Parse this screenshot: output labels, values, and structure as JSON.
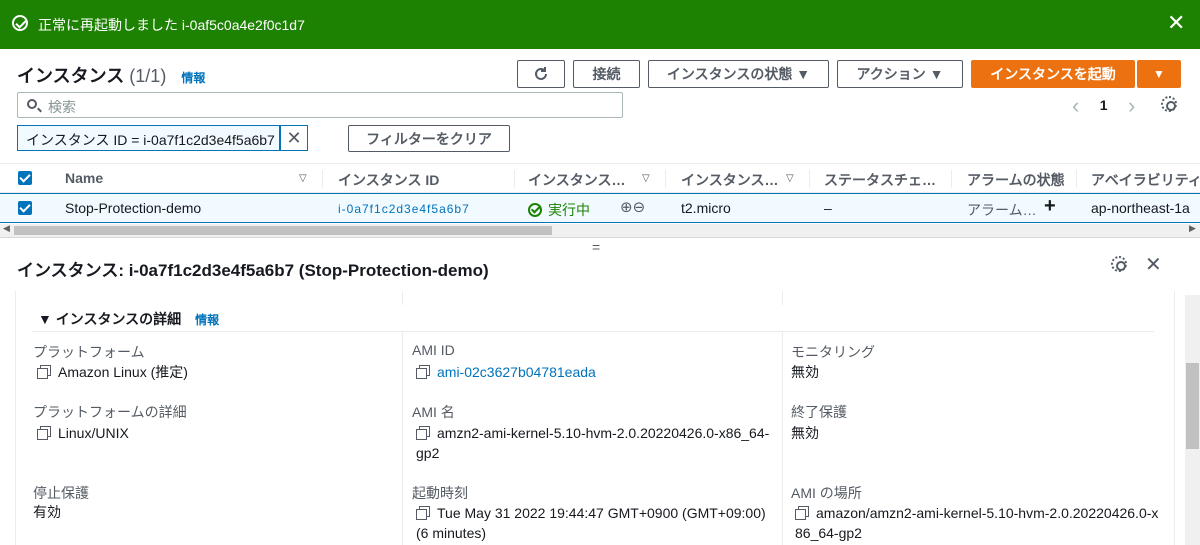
{
  "banner": {
    "message": "正常に再起動しました i-0af5c0a4e2f0c1d7",
    "close_icon": "✕"
  },
  "header": {
    "title": "インスタンス",
    "count": "(1/1)",
    "info": "情報",
    "connect_label": "接続",
    "state_label": "インスタンスの状態 ▼",
    "actions_label": "アクション ▼",
    "launch_label": "インスタンスを起動",
    "launch_dropdown": "▼"
  },
  "search": {
    "placeholder": "検索"
  },
  "filter": {
    "token": "インスタンス ID = i-0a7f1c2d3e4f5a6b7",
    "clear_label": "フィルターをクリア"
  },
  "pager": {
    "prev": "‹",
    "page": "1",
    "next": "›"
  },
  "table": {
    "headers": [
      "Name",
      "インスタンス ID",
      "インスタンス…",
      "インスタンス…",
      "ステータスチェ…",
      "アラームの状態",
      "アベイラビリティ…"
    ],
    "row": {
      "name": "Stop-Protection-demo",
      "instance_id": "i-0a7f1c2d3e4f5a6b7",
      "state": "実行中",
      "type": "t2.micro",
      "status_check": "–",
      "alarm": "アラーム…",
      "alarm_add": "+",
      "az": "ap-northeast-1a"
    }
  },
  "detail": {
    "grip": "=",
    "title": "インスタンス: i-0a7f1c2d3e4f5a6b7 (Stop-Protection-demo)",
    "section_title": "▼ インスタンスの詳細",
    "section_info": "情報",
    "fields": {
      "platform_label": "プラットフォーム",
      "platform_value": "Amazon Linux (推定)",
      "ami_id_label": "AMI ID",
      "ami_id_value": "ami-02c3627b04781eada",
      "monitoring_label": "モニタリング",
      "monitoring_value": "無効",
      "platform_details_label": "プラットフォームの詳細",
      "platform_details_value": "Linux/UNIX",
      "ami_name_label": "AMI 名",
      "ami_name_value": "amzn2-ami-kernel-5.10-hvm-2.0.20220426.0-x86_64-gp2",
      "term_protect_label": "終了保護",
      "term_protect_value": "無効",
      "stop_protect_label": "停止保護",
      "stop_protect_value": "有効",
      "launch_time_label": "起動時刻",
      "launch_time_value": "Tue May 31 2022 19:44:47 GMT+0900 (GMT+09:00) (6 minutes)",
      "ami_location_label": "AMI の場所",
      "ami_location_value": "amazon/amzn2-ami-kernel-5.10-hvm-2.0.20220426.0-x86_64-gp2"
    }
  },
  "colors": {
    "success": "#1d8102",
    "primary": "#ec7211",
    "link": "#0073bb"
  }
}
